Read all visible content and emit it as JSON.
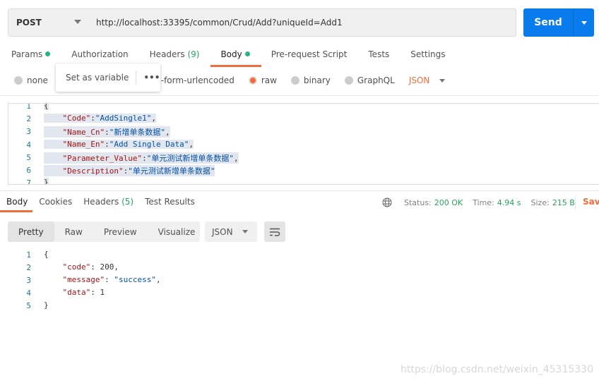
{
  "request": {
    "method": "POST",
    "url": "http://localhost:33395/common/Crud/Add?uniqueId=Add1",
    "send_label": "Send"
  },
  "tabs": [
    {
      "label": "Params",
      "dot": true
    },
    {
      "label": "Authorization"
    },
    {
      "label": "Headers",
      "count": "(9)"
    },
    {
      "label": "Body",
      "dot": true,
      "active": true
    },
    {
      "label": "Pre-request Script"
    },
    {
      "label": "Tests"
    },
    {
      "label": "Settings"
    }
  ],
  "body_types": {
    "none": "none",
    "urlencoded": "x-www-form-urlencoded",
    "urlencoded_visible": "w-form-urlencoded",
    "raw": "raw",
    "binary": "binary",
    "graphql": "GraphQL",
    "format": "JSON",
    "selected": "raw"
  },
  "popup": {
    "label": "Set as variable",
    "more": "•••"
  },
  "request_body": [
    {
      "n": "1",
      "code": "{"
    },
    {
      "n": "2",
      "key": "\"Code\"",
      "val": "\"AddSingle1\"",
      "tail": ","
    },
    {
      "n": "3",
      "key": "\"Name_Cn\"",
      "val": "\"新增单条数据\"",
      "tail": ","
    },
    {
      "n": "4",
      "key": "\"Name_En\"",
      "val": "\"Add Single Data\"",
      "tail": ","
    },
    {
      "n": "5",
      "key": "\"Parameter_Value\"",
      "val": "\"单元测试新增单条数据\"",
      "tail": ","
    },
    {
      "n": "6",
      "key": "\"Description\"",
      "val": "\"单元测试新增单条数据\"",
      "tail": ""
    },
    {
      "n": "7",
      "code": "}"
    }
  ],
  "response": {
    "tabs": [
      {
        "label": "Body",
        "active": true
      },
      {
        "label": "Cookies"
      },
      {
        "label": "Headers",
        "count": "(5)"
      },
      {
        "label": "Test Results"
      }
    ],
    "status_label": "Status:",
    "status": "200 OK",
    "time_label": "Time:",
    "time": "4.94 s",
    "size_label": "Size:",
    "size": "215 B",
    "save": "Save",
    "views": [
      "Pretty",
      "Raw",
      "Preview",
      "Visualize"
    ],
    "active_view": "Pretty",
    "format": "JSON",
    "body": [
      {
        "n": "1",
        "code": "{"
      },
      {
        "n": "2",
        "key": "\"code\"",
        "val": "200",
        "tail": ","
      },
      {
        "n": "3",
        "key": "\"message\"",
        "val": "\"success\"",
        "tail": ","
      },
      {
        "n": "4",
        "key": "\"data\"",
        "val": "1",
        "tail": ""
      },
      {
        "n": "5",
        "code": "}"
      }
    ]
  },
  "watermark": "https://blog.csdn.net/weixin_45315330",
  "colors": {
    "accent": "#f26b3a",
    "send": "#097bed",
    "success": "#26a65b"
  }
}
